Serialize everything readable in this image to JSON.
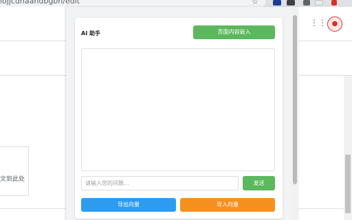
{
  "browser": {
    "url_fragment": "lojjcdnaandbgbn/edit",
    "icons": [
      "bookmark-star-icon",
      "extension-icon",
      "extension-icon",
      "extension-icon",
      "extension-icon",
      "profile-icon"
    ]
  },
  "page": {
    "drop_hint": "文到此处",
    "icons": [
      "apps-grid-icon",
      "more-vert-icon"
    ]
  },
  "panel": {
    "title": "AI 助手",
    "embed_button": "页面内容嵌入",
    "input_placeholder": "请输入您的问题...",
    "send_button": "发送",
    "export_button": "导出向量",
    "import_button": "导入向量"
  },
  "colors": {
    "green": "#5cb85c",
    "blue": "#2d9cf0",
    "orange": "#f5901f"
  }
}
